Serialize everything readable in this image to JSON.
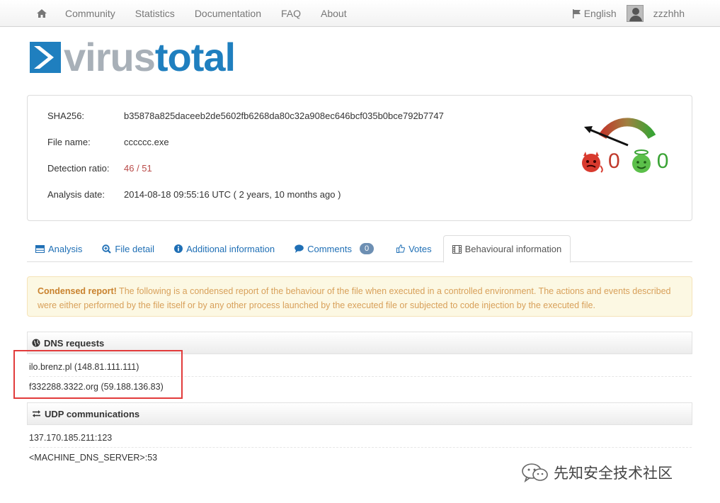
{
  "nav": {
    "items": [
      "Community",
      "Statistics",
      "Documentation",
      "FAQ",
      "About"
    ],
    "language": "English",
    "username": "zzzhhh"
  },
  "logo": {
    "virus": "virus",
    "total": "total"
  },
  "summary": {
    "sha256_label": "SHA256:",
    "sha256_value": "b35878a825daceeb2de5602fb6268da80c32a908ec646bcf035b0bce792b7747",
    "filename_label": "File name:",
    "filename_value": "cccccc.exe",
    "ratio_label": "Detection ratio:",
    "ratio_value": "46 / 51",
    "date_label": "Analysis date:",
    "date_value": "2014-08-18 09:55:16 UTC ( 2 years, 10 months ago )",
    "malicious_votes": "0",
    "harmless_votes": "0"
  },
  "tabs": {
    "analysis": "Analysis",
    "file_detail": "File detail",
    "additional": "Additional information",
    "comments": "Comments",
    "comments_count": "0",
    "votes": "Votes",
    "behavioural": "Behavioural information"
  },
  "alert": {
    "title": "Condensed report!",
    "body": " The following is a condensed report of the behaviour of the file when executed in a controlled environment. The actions and events described were either performed by the file itself or by any other process launched by the executed file or subjected to code injection by the executed file."
  },
  "dns": {
    "title": "DNS requests",
    "items": [
      "ilo.brenz.pl (148.81.111.111)",
      "f332288.3322.org (59.188.136.83)"
    ]
  },
  "udp": {
    "title": "UDP communications",
    "items": [
      "137.170.185.211:123",
      "<MACHINE_DNS_SERVER>:53"
    ]
  },
  "watermark": "先知安全技术社区",
  "colors": {
    "accent": "#1f6fb5",
    "danger": "#b94a48",
    "brand": "#1f7fbf",
    "highlight_box": "#e23b3b"
  }
}
